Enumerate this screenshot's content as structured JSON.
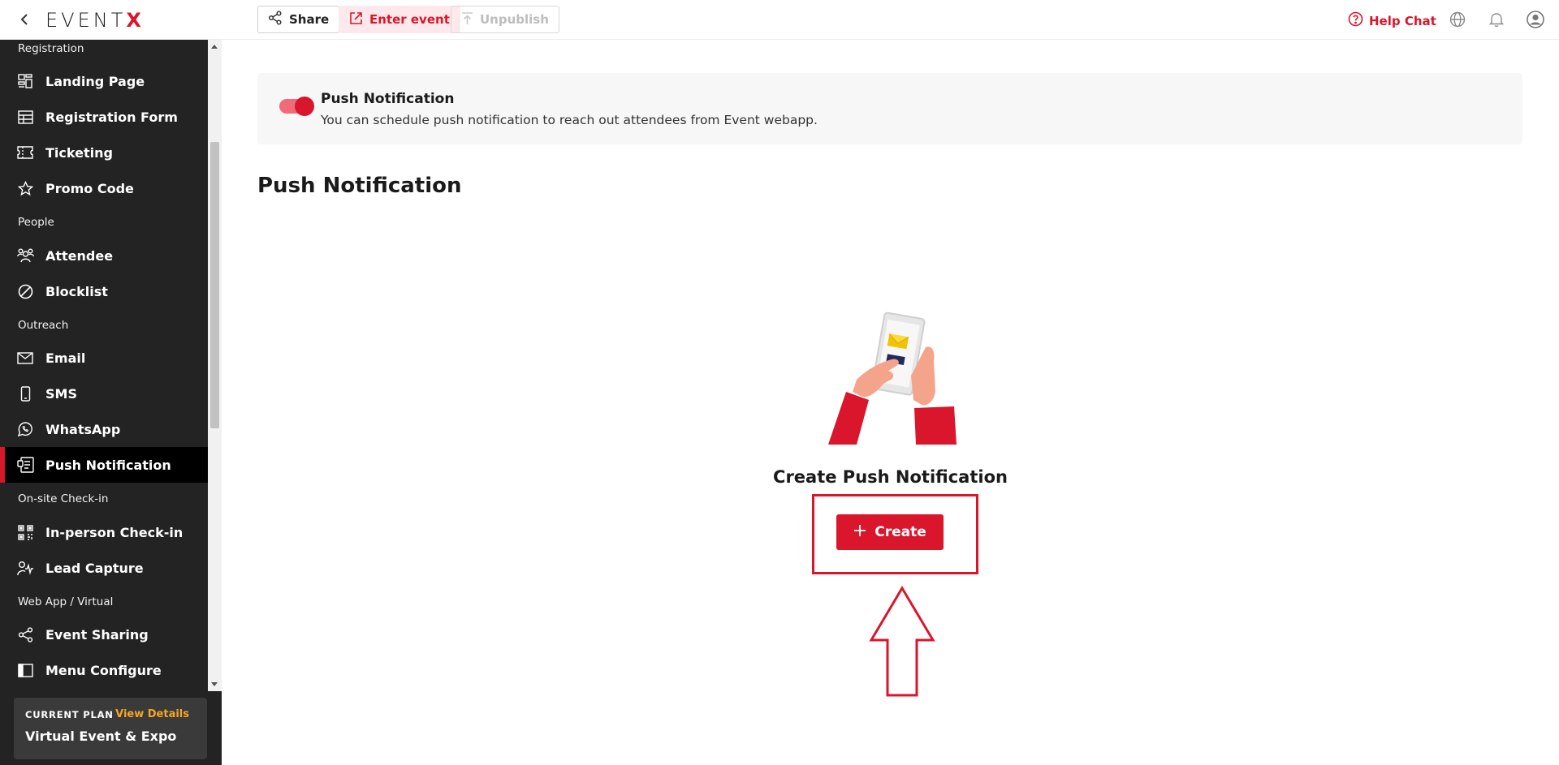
{
  "topbar": {
    "logo_main": "EVENT",
    "logo_accent": "X",
    "share_label": "Share",
    "enter_label": "Enter event",
    "unpublish_label": "Unpublish",
    "help_label": "Help Chat"
  },
  "sidebar": {
    "sections": {
      "registration": "Registration",
      "people": "People",
      "outreach": "Outreach",
      "onsite": "On-site Check-in",
      "webapp": "Web App / Virtual"
    },
    "items": [
      {
        "label": "Landing Page",
        "icon": "layout-icon"
      },
      {
        "label": "Registration Form",
        "icon": "table-icon"
      },
      {
        "label": "Ticketing",
        "icon": "ticket-icon"
      },
      {
        "label": "Promo Code",
        "icon": "star-icon"
      },
      {
        "label": "Attendee",
        "icon": "users-icon"
      },
      {
        "label": "Blocklist",
        "icon": "block-icon"
      },
      {
        "label": "Email",
        "icon": "mail-icon"
      },
      {
        "label": "SMS",
        "icon": "phone-icon"
      },
      {
        "label": "WhatsApp",
        "icon": "whatsapp-icon"
      },
      {
        "label": "Push Notification",
        "icon": "push-icon"
      },
      {
        "label": "In-person Check-in",
        "icon": "qr-icon"
      },
      {
        "label": "Lead Capture",
        "icon": "lead-icon"
      },
      {
        "label": "Event Sharing",
        "icon": "share-icon"
      },
      {
        "label": "Menu Configure",
        "icon": "sidebar-icon"
      }
    ],
    "active_item": "Push Notification",
    "plan": {
      "label": "CURRENT PLAN",
      "link": "View Details",
      "name": "Virtual Event & Expo"
    }
  },
  "main": {
    "banner": {
      "title": "Push Notification",
      "description": "You can schedule push notification to reach out attendees from Event webapp.",
      "toggle_on": true
    },
    "page_title": "Push Notification",
    "empty_state": {
      "title": "Create Push Notification",
      "button_label": "Create"
    }
  },
  "colors": {
    "brand_red": "#d9162c",
    "sidebar_bg": "#232323",
    "plan_link": "#f5a623"
  }
}
